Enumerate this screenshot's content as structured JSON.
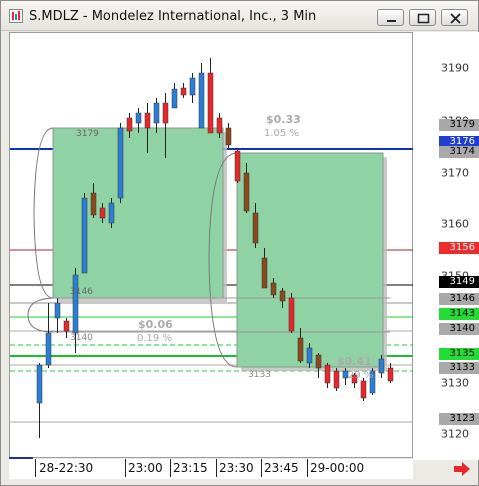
{
  "window": {
    "title": "S.MDLZ - Mondelez International, Inc., 3 Min",
    "colors": {
      "chrome": "#ebeae5",
      "accent_red": "#e8272b",
      "accent_blue": "#1f3fcf"
    }
  },
  "price_axis": {
    "ticks": [
      "3190",
      "3180",
      "3170",
      "3160",
      "3150",
      "3140",
      "3130",
      "3120"
    ]
  },
  "price_tags": [
    {
      "label": "3179",
      "bg": "#a9a9a9",
      "fg": "#000000"
    },
    {
      "label": "3176",
      "bg": "#1f3fcf",
      "fg": "#ffffff"
    },
    {
      "label": "3174",
      "bg": "#a9a9a9",
      "fg": "#000000"
    },
    {
      "label": "3156",
      "bg": "#ec2b2b",
      "fg": "#ffffff"
    },
    {
      "label": "3149",
      "bg": "#000000",
      "fg": "#ffffff"
    },
    {
      "label": "3146",
      "bg": "#a9a9a9",
      "fg": "#000000"
    },
    {
      "label": "3143",
      "bg": "#22dd33",
      "fg": "#000000"
    },
    {
      "label": "3140",
      "bg": "#a9a9a9",
      "fg": "#000000"
    },
    {
      "label": "3135",
      "bg": "#22dd33",
      "fg": "#000000"
    },
    {
      "label": "3133",
      "bg": "#a9a9a9",
      "fg": "#000000"
    },
    {
      "label": "3123",
      "bg": "#a9a9a9",
      "fg": "#000000"
    }
  ],
  "time_axis": {
    "labels": [
      "28-22:30",
      "23:00",
      "23:15",
      "23:30",
      "23:45",
      "29-00:00"
    ]
  },
  "annotations": {
    "box1_top_label": "3179",
    "box1_bottom_label": "3146",
    "box1_change": "$0.33",
    "box1_pct": "1.05 %",
    "box2_top_label": "3140",
    "box2_change": "$0.06",
    "box2_pct": "0.19 %",
    "box3_bottom_label": "3133",
    "box3_change": "$0.41",
    "box3_pct": "29 %"
  }
}
